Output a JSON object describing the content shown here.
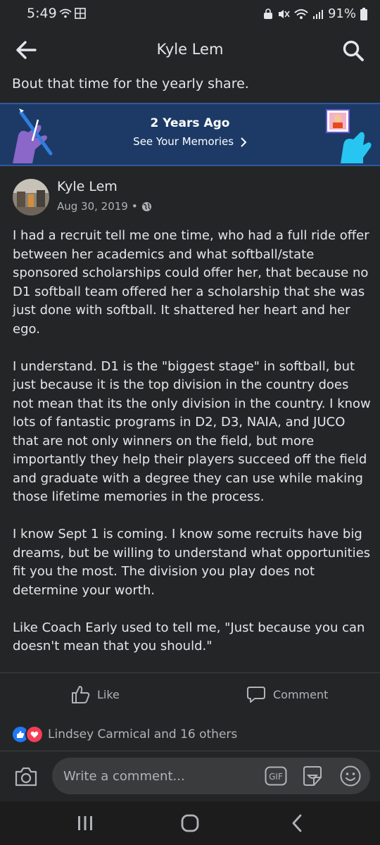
{
  "status_bar": {
    "time": "5:49",
    "battery": "91%"
  },
  "header": {
    "title": "Kyle Lem"
  },
  "post": {
    "share_caption": "Bout that time for the yearly share.",
    "memories": {
      "title": "2 Years Ago",
      "link": "See Your Memories"
    },
    "author": "Kyle Lem",
    "date": "Aug 30, 2019",
    "date_separator": "•",
    "paragraphs": [
      "I had a recruit tell me one time, who had a full ride offer between her academics and what softball/state sponsored scholarships could offer her, that because no D1 softball team offered her a scholarship that she was just done with softball.  It shattered her heart and her ego.",
      "I understand.  D1 is the \"biggest stage\" in softball, but just because it is the top division in the country does not mean that its the only division in the country.  I know lots of fantastic programs in D2, D3, NAIA, and JUCO that are not only winners on the field, but more importantly they help their players succeed off the field and graduate with a degree they can use while making those lifetime memories in the process.",
      "I know Sept 1 is coming.  I know some recruits have big dreams, but be willing to understand what opportunities fit you the most.  The division you play does not determine your worth.",
      "Like Coach Early used to tell me, \"Just because you can doesn't mean that you should.\""
    ]
  },
  "actions": {
    "like": "Like",
    "comment": "Comment"
  },
  "reactions": {
    "summary": "Lindsey Carmical and 16 others"
  },
  "composer": {
    "placeholder": "Write a comment...",
    "gif": "GIF"
  },
  "colors": {
    "background": "#242526",
    "banner": "#1d3a66",
    "like_blue": "#2078f4",
    "love_red": "#f33e58"
  },
  "icons": [
    "back-arrow-icon",
    "search-icon",
    "globe-icon",
    "like-icon",
    "comment-icon",
    "camera-icon",
    "gif-icon",
    "sticker-icon",
    "emoji-icon"
  ]
}
